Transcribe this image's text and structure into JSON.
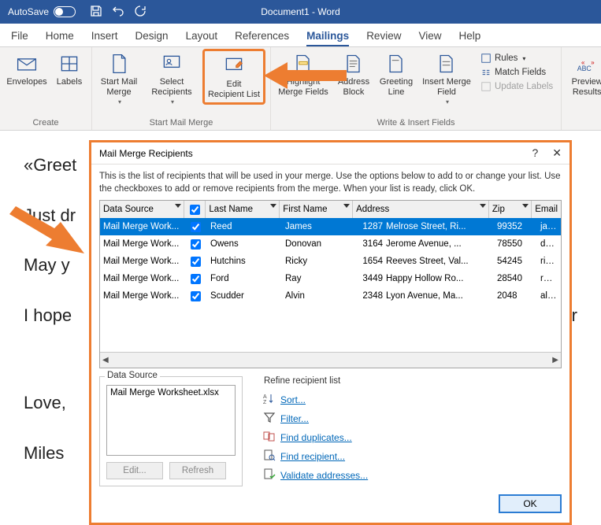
{
  "titlebar": {
    "autosave": "AutoSave",
    "doc_title": "Document1 - Word"
  },
  "tabs": [
    "File",
    "Home",
    "Insert",
    "Design",
    "Layout",
    "References",
    "Mailings",
    "Review",
    "View",
    "Help"
  ],
  "active_tab": "Mailings",
  "ribbon": {
    "create": {
      "label": "Create",
      "envelopes": "Envelopes",
      "labels": "Labels"
    },
    "smm": {
      "label": "Start Mail Merge",
      "start": "Start Mail\nMerge",
      "select": "Select\nRecipients",
      "edit": "Edit\nRecipient List"
    },
    "wif": {
      "label": "Write & Insert Fields",
      "highlight": "Highlight\nMerge Fields",
      "address": "Address\nBlock",
      "greeting": "Greeting\nLine",
      "insert": "Insert Merge\nField",
      "rules": "Rules",
      "match": "Match Fields",
      "update": "Update Labels"
    },
    "preview": {
      "preview": "Preview\nResults"
    }
  },
  "document": {
    "p1": "«Greet",
    "p2": "Just dr",
    "p3": "May y",
    "p4": "I hope",
    "p4b": "tir",
    "p5": "Love,",
    "p6": "Miles "
  },
  "dialog": {
    "title": "Mail Merge Recipients",
    "note": "This is the list of recipients that will be used in your merge.  Use the options below to add to or change your list. Use the checkboxes to add or remove recipients from the merge.  When your list is ready, click OK.",
    "headers": {
      "ds": "Data Source",
      "ln": "Last Name",
      "fn": "First Name",
      "addr": "Address",
      "zip": "Zip",
      "em": "Email"
    },
    "rows": [
      {
        "ds": "Mail Merge Work...",
        "ln": "Reed",
        "fn": "James",
        "num": "1287",
        "addr": "Melrose Street, Ri...",
        "zip": "99352",
        "em": "jamesre"
      },
      {
        "ds": "Mail Merge Work...",
        "ln": "Owens",
        "fn": "Donovan",
        "num": "3164",
        "addr": "Jerome Avenue, ...",
        "zip": "78550",
        "em": "donova"
      },
      {
        "ds": "Mail Merge Work...",
        "ln": "Hutchins",
        "fn": "Ricky",
        "num": "1654",
        "addr": "Reeves Street, Val...",
        "zip": "54245",
        "em": "rickyhut"
      },
      {
        "ds": "Mail Merge Work...",
        "ln": "Ford",
        "fn": "Ray",
        "num": "3449",
        "addr": "Happy Hollow Ro...",
        "zip": "28540",
        "em": "rayford("
      },
      {
        "ds": "Mail Merge Work...",
        "ln": "Scudder",
        "fn": "Alvin",
        "num": "2348",
        "addr": "Lyon Avenue, Ma...",
        "zip": "2048",
        "em": "alvinscu"
      }
    ],
    "data_source_legend": "Data Source",
    "data_source_file": "Mail Merge Worksheet.xlsx",
    "edit_btn": "Edit...",
    "refresh_btn": "Refresh",
    "refine_legend": "Refine recipient list",
    "refine": [
      "Sort...",
      "Filter...",
      "Find duplicates...",
      "Find recipient...",
      "Validate addresses..."
    ],
    "ok": "OK"
  }
}
